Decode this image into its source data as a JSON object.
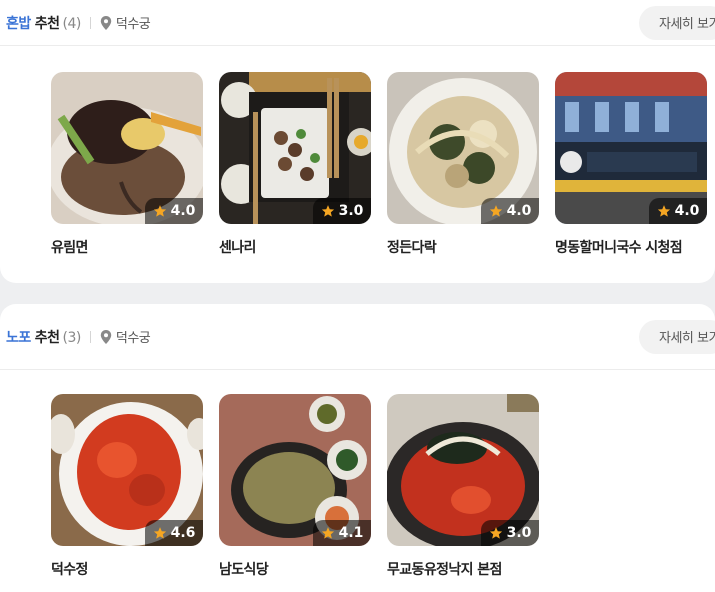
{
  "sections": [
    {
      "keyword": "혼밥",
      "word": "추천",
      "count": "(4)",
      "location": "덕수궁",
      "more_label": "자세히 보기",
      "cards": [
        {
          "name": "유림면",
          "rating": "4.0"
        },
        {
          "name": "센나리",
          "rating": "3.0"
        },
        {
          "name": "정든다락",
          "rating": "4.0"
        },
        {
          "name": "명동할머니국수 시청점",
          "rating": "4.0"
        }
      ]
    },
    {
      "keyword": "노포",
      "word": "추천",
      "count": "(3)",
      "location": "덕수궁",
      "more_label": "자세히 보기",
      "cards": [
        {
          "name": "덕수정",
          "rating": "4.6"
        },
        {
          "name": "남도식당",
          "rating": "4.1"
        },
        {
          "name": "무교동유정낙지 본점",
          "rating": "3.0"
        }
      ]
    }
  ],
  "colors": {
    "keyword": "#3b74d6",
    "star": "#f5a623"
  },
  "icons": {
    "location": "map-pin-icon",
    "rating": "star-icon"
  }
}
